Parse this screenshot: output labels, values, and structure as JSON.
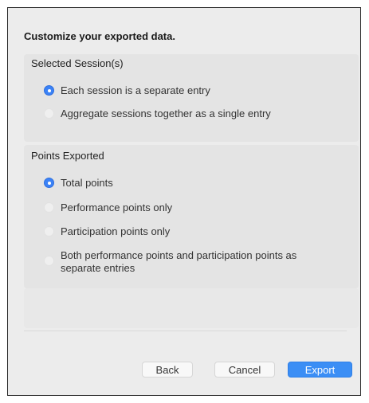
{
  "dialog": {
    "heading": "Customize your exported data."
  },
  "sessions": {
    "title": "Selected Session(s)",
    "options": [
      {
        "label": "Each session is a separate entry",
        "selected": true
      },
      {
        "label": "Aggregate sessions together as a single entry",
        "selected": false
      }
    ]
  },
  "points": {
    "title": "Points Exported",
    "options": [
      {
        "label": "Total points",
        "selected": true
      },
      {
        "label": "Performance points only",
        "selected": false
      },
      {
        "label": "Participation points only",
        "selected": false
      },
      {
        "label": "Both performance points and participation points as separate entries",
        "selected": false
      }
    ]
  },
  "buttons": {
    "back": "Back",
    "cancel": "Cancel",
    "export": "Export"
  },
  "colors": {
    "accent": "#3b8ef5"
  }
}
